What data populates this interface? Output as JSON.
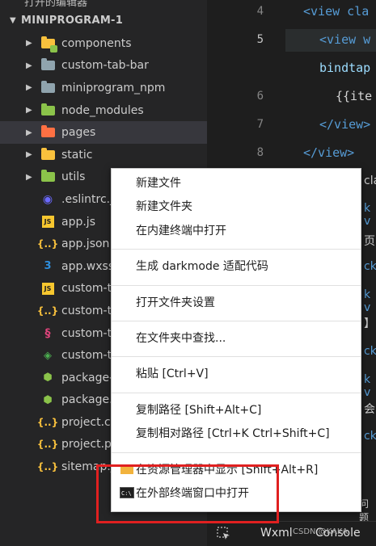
{
  "explorer": {
    "top_cut_label": "打开的编辑器",
    "root_label": "MINIPROGRAM-1",
    "items": [
      {
        "label": "components",
        "kind": "folder",
        "color": "#f9c13d",
        "badge": "#8bc34a",
        "icon": "components-folder-icon"
      },
      {
        "label": "custom-tab-bar",
        "kind": "folder",
        "color": "#90a4ae",
        "icon": "folder-icon"
      },
      {
        "label": "miniprogram_npm",
        "kind": "folder",
        "color": "#90a4ae",
        "icon": "folder-icon"
      },
      {
        "label": "node_modules",
        "kind": "folder",
        "color": "#8bc34a",
        "icon": "node-modules-folder-icon"
      },
      {
        "label": "pages",
        "kind": "folder",
        "color": "#ff7043",
        "selected": true,
        "icon": "pages-folder-icon"
      },
      {
        "label": "static",
        "kind": "folder",
        "color": "#f9c13d",
        "icon": "static-folder-icon"
      },
      {
        "label": "utils",
        "kind": "folder",
        "color": "#8bc34a",
        "icon": "utils-folder-icon"
      },
      {
        "label": ".eslintrc.js",
        "kind": "file",
        "glyph": "◉",
        "cls": "ic-eslint",
        "icon": "eslint-file-icon"
      },
      {
        "label": "app.js",
        "kind": "file",
        "glyph": "JS",
        "cls": "ic-js",
        "icon": "js-file-icon"
      },
      {
        "label": "app.json",
        "kind": "file",
        "glyph": "{..}",
        "cls": "ic-json",
        "icon": "json-file-icon"
      },
      {
        "label": "app.wxss",
        "kind": "file",
        "glyph": "3",
        "cls": "ic-css",
        "icon": "css-file-icon"
      },
      {
        "label": "custom-t",
        "kind": "file",
        "glyph": "JS",
        "cls": "ic-js",
        "icon": "js-file-icon"
      },
      {
        "label": "custom-t",
        "kind": "file",
        "glyph": "{..}",
        "cls": "ic-json",
        "icon": "json-file-icon"
      },
      {
        "label": "custom-t",
        "kind": "file",
        "glyph": "§",
        "cls": "ic-sass",
        "icon": "sass-file-icon"
      },
      {
        "label": "custom-t",
        "kind": "file",
        "glyph": "◈",
        "cls": "ic-green",
        "icon": "wxml-file-icon"
      },
      {
        "label": "package-",
        "kind": "file",
        "glyph": "⬢",
        "cls": "ic-node",
        "icon": "node-file-icon"
      },
      {
        "label": "package.",
        "kind": "file",
        "glyph": "⬢",
        "cls": "ic-node",
        "icon": "node-file-icon"
      },
      {
        "label": "project.co",
        "kind": "file",
        "glyph": "{..}",
        "cls": "ic-json",
        "icon": "json-file-icon"
      },
      {
        "label": "project.p",
        "kind": "file",
        "glyph": "{..}",
        "cls": "ic-json",
        "icon": "json-file-icon"
      },
      {
        "label": "sitemap.j",
        "kind": "file",
        "glyph": "{..}",
        "cls": "ic-json",
        "icon": "json-file-icon"
      }
    ]
  },
  "editor": {
    "line_numbers": [
      "4",
      "5",
      "",
      "6",
      "7",
      "8"
    ],
    "active_line": "5",
    "code_lines": [
      "<view cla",
      "<view w",
      "bindtap",
      "{{ite",
      "</view>",
      "</view>"
    ],
    "right_strip": [
      "cla",
      "k v",
      "页",
      "ck",
      "k v",
      "】",
      "ck",
      "k v",
      "会",
      "ck"
    ]
  },
  "context_menu": {
    "groups": [
      [
        "新建文件",
        "新建文件夹",
        "在内建终端中打开"
      ],
      [
        "生成 darkmode 适配代码"
      ],
      [
        "打开文件夹设置"
      ],
      [
        "在文件夹中查找..."
      ],
      [
        "粘贴  [Ctrl+V]"
      ],
      [
        "复制路径  [Shift+Alt+C]",
        "复制相对路径  [Ctrl+K Ctrl+Shift+C]"
      ],
      [
        "在资源管理器中显示  [Shift+Alt+R]",
        "在外部终端窗口中打开"
      ]
    ]
  },
  "bottom_bar": {
    "tab_wxml": "Wxml",
    "tab_console": "Console",
    "watermark": "CSDN @KAKA",
    "problems_label": "问题"
  },
  "colors": {
    "highlight_box": "#e02020",
    "selected_row": "#37373d",
    "menu_bg": "#ffffff"
  }
}
